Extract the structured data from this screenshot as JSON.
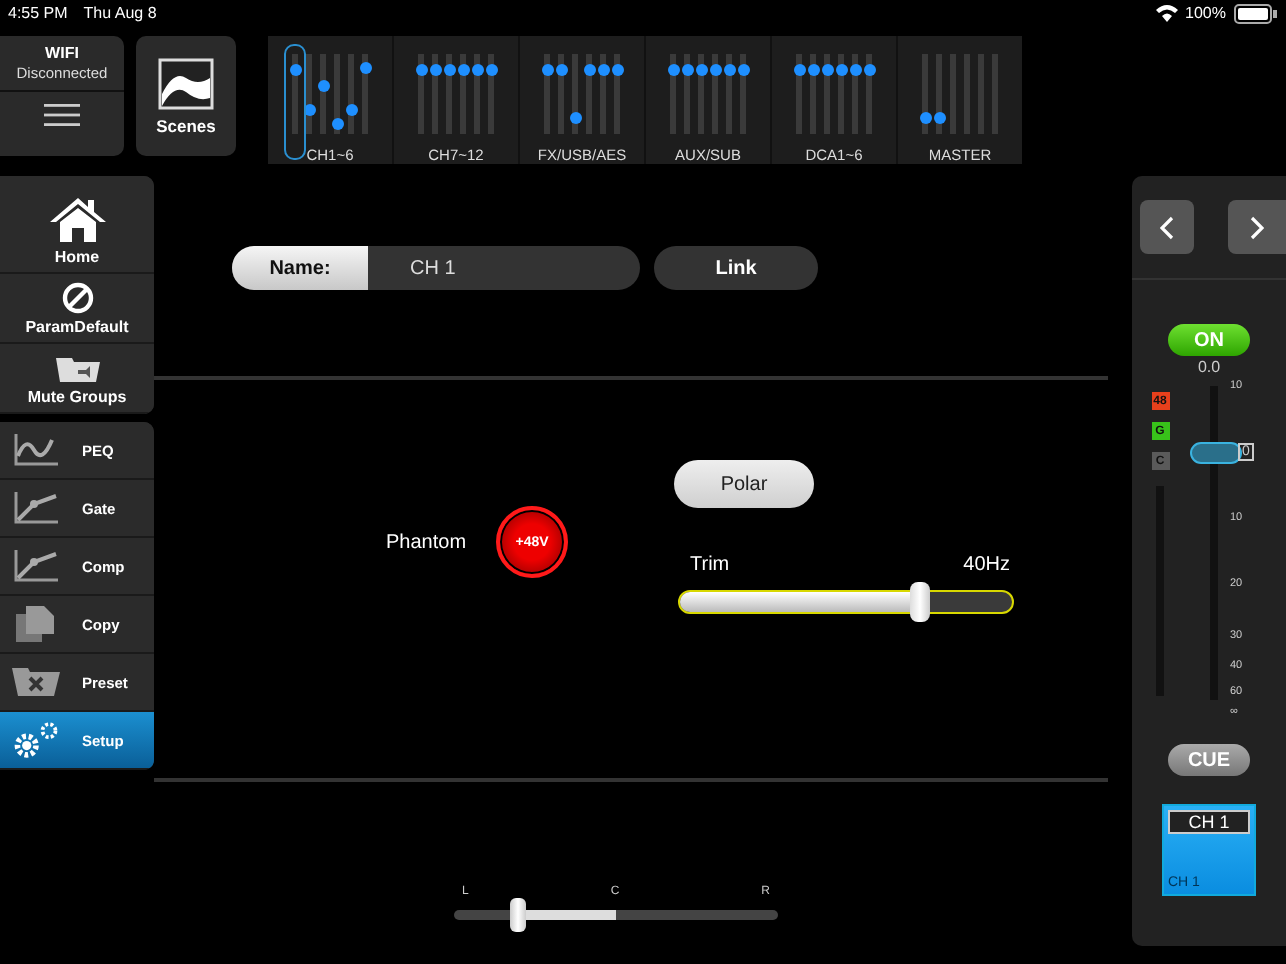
{
  "status_bar": {
    "time": "4:55 PM",
    "date": "Thu Aug 8",
    "battery": "100%"
  },
  "wifi": {
    "title": "WIFI",
    "status": "Disconnected"
  },
  "scenes": {
    "label": "Scenes"
  },
  "banks": [
    {
      "label": "CH1~6",
      "selected": true,
      "faders": [
        {
          "level": 0.81
        },
        {
          "level": 0.31
        },
        {
          "level": 0.6
        },
        {
          "level": 0.12
        },
        {
          "level": 0.29
        },
        {
          "level": 0.83
        }
      ]
    },
    {
      "label": "CH7~12",
      "selected": false,
      "faders": [
        {
          "level": 0.81
        },
        {
          "level": 0.81
        },
        {
          "level": 0.81
        },
        {
          "level": 0.81
        },
        {
          "level": 0.81
        },
        {
          "level": 0.81
        }
      ]
    },
    {
      "label": "FX/USB/AES",
      "selected": false,
      "faders": [
        {
          "level": 0.81
        },
        {
          "level": 0.81
        },
        {
          "level": 0.19
        },
        {
          "level": 0.81
        },
        {
          "level": 0.81
        },
        {
          "level": 0.81
        }
      ]
    },
    {
      "label": "AUX/SUB",
      "selected": false,
      "faders": [
        {
          "level": 0.81
        },
        {
          "level": 0.81
        },
        {
          "level": 0.81
        },
        {
          "level": 0.81
        },
        {
          "level": 0.81
        },
        {
          "level": 0.81
        }
      ]
    },
    {
      "label": "DCA1~6",
      "selected": false,
      "faders": [
        {
          "level": 0.81
        },
        {
          "level": 0.81
        },
        {
          "level": 0.81
        },
        {
          "level": 0.81
        },
        {
          "level": 0.81
        },
        {
          "level": 0.81
        }
      ]
    },
    {
      "label": "MASTER",
      "selected": false,
      "faders": [
        {
          "level": 0.19
        },
        {
          "level": 0.19
        }
      ]
    }
  ],
  "nav": [
    {
      "label": "Home",
      "kind": "home"
    },
    {
      "label": "ParamDefault",
      "kind": "default"
    },
    {
      "label": "Mute Groups",
      "kind": "mute"
    }
  ],
  "tools": [
    {
      "label": "PEQ",
      "kind": "peq",
      "selected": false
    },
    {
      "label": "Gate",
      "kind": "gate",
      "selected": false
    },
    {
      "label": "Comp",
      "kind": "comp",
      "selected": false
    },
    {
      "label": "Copy",
      "kind": "copy",
      "selected": false
    },
    {
      "label": "Preset",
      "kind": "preset",
      "selected": false
    },
    {
      "label": "Setup",
      "kind": "setup",
      "selected": true
    }
  ],
  "name_row": {
    "label": "Name:",
    "value": "CH 1",
    "link": "Link"
  },
  "phantom": {
    "label": "Phantom",
    "button": "+48V",
    "on": true
  },
  "polar": {
    "label": "Polar",
    "on": false
  },
  "trim": {
    "label": "Trim",
    "reading": "40Hz",
    "level": 0.72
  },
  "pan": {
    "left": "L",
    "center": "C",
    "right": "R",
    "level": 0.2
  },
  "strip": {
    "on_label": "ON",
    "on": true,
    "gain": "0.0",
    "indicators": [
      {
        "label": "48",
        "color": "#e8401c"
      },
      {
        "label": "G",
        "color": "#38c21a"
      },
      {
        "label": "C",
        "color": "#5a5a5a"
      }
    ],
    "scale": [
      "10",
      "0",
      "10",
      "20",
      "30",
      "40",
      "60",
      "∞"
    ],
    "fader": {
      "level": 0.79
    },
    "cue": "CUE",
    "channel_name": "CH 1",
    "channel_label": "CH 1"
  }
}
